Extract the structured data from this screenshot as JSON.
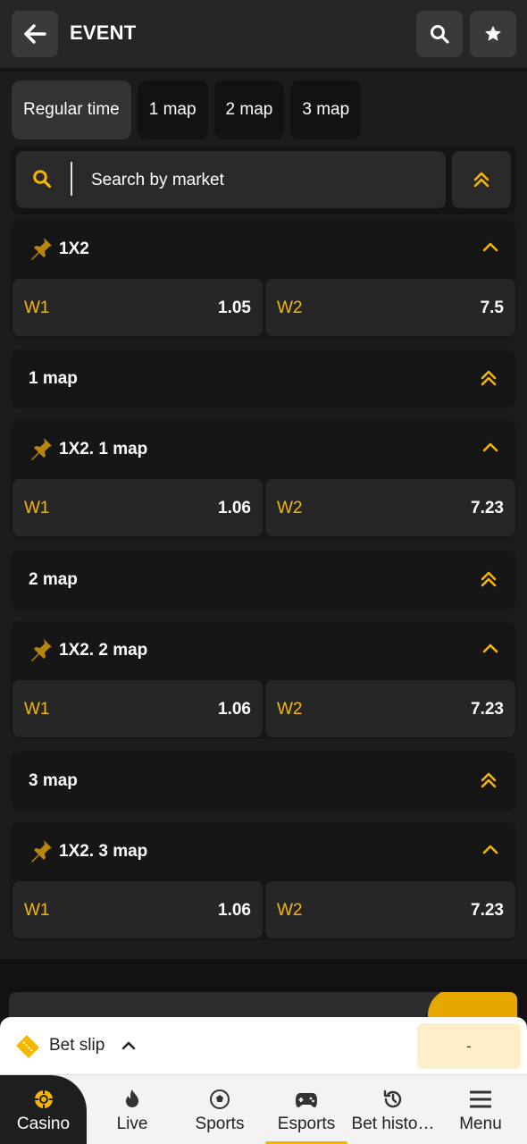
{
  "header": {
    "title": "EVENT"
  },
  "tabs": [
    {
      "label": "Regular time",
      "active": true
    },
    {
      "label": "1 map",
      "active": false
    },
    {
      "label": "2 map",
      "active": false
    },
    {
      "label": "3 map",
      "active": false
    }
  ],
  "search": {
    "placeholder": "Search by market"
  },
  "markets": [
    {
      "name": "1X2",
      "odds": [
        {
          "label": "W1",
          "value": "1.05"
        },
        {
          "label": "W2",
          "value": "7.5"
        }
      ]
    },
    {
      "name": "1X2. 1 map",
      "odds": [
        {
          "label": "W1",
          "value": "1.06"
        },
        {
          "label": "W2",
          "value": "7.23"
        }
      ]
    },
    {
      "name": "1X2. 2 map",
      "odds": [
        {
          "label": "W1",
          "value": "1.06"
        },
        {
          "label": "W2",
          "value": "7.23"
        }
      ]
    },
    {
      "name": "1X2. 3 map",
      "odds": [
        {
          "label": "W1",
          "value": "1.06"
        },
        {
          "label": "W2",
          "value": "7.23"
        }
      ]
    }
  ],
  "groups": [
    {
      "name": "1 map"
    },
    {
      "name": "2 map"
    },
    {
      "name": "3 map"
    }
  ],
  "betslip": {
    "label": "Bet slip",
    "value": "-"
  },
  "nav": [
    {
      "label": "Casino",
      "icon": "casino-chip-icon"
    },
    {
      "label": "Live",
      "icon": "flame-icon"
    },
    {
      "label": "Sports",
      "icon": "soccer-ball-icon"
    },
    {
      "label": "Esports",
      "icon": "gamepad-icon",
      "active": true
    },
    {
      "label": "Bet histo…",
      "icon": "history-icon"
    },
    {
      "label": "Menu",
      "icon": "hamburger-menu-icon"
    }
  ],
  "colors": {
    "accent": "#f5b600",
    "background": "#1c1c1c",
    "card": "#161616",
    "odd_cell": "#262626"
  }
}
